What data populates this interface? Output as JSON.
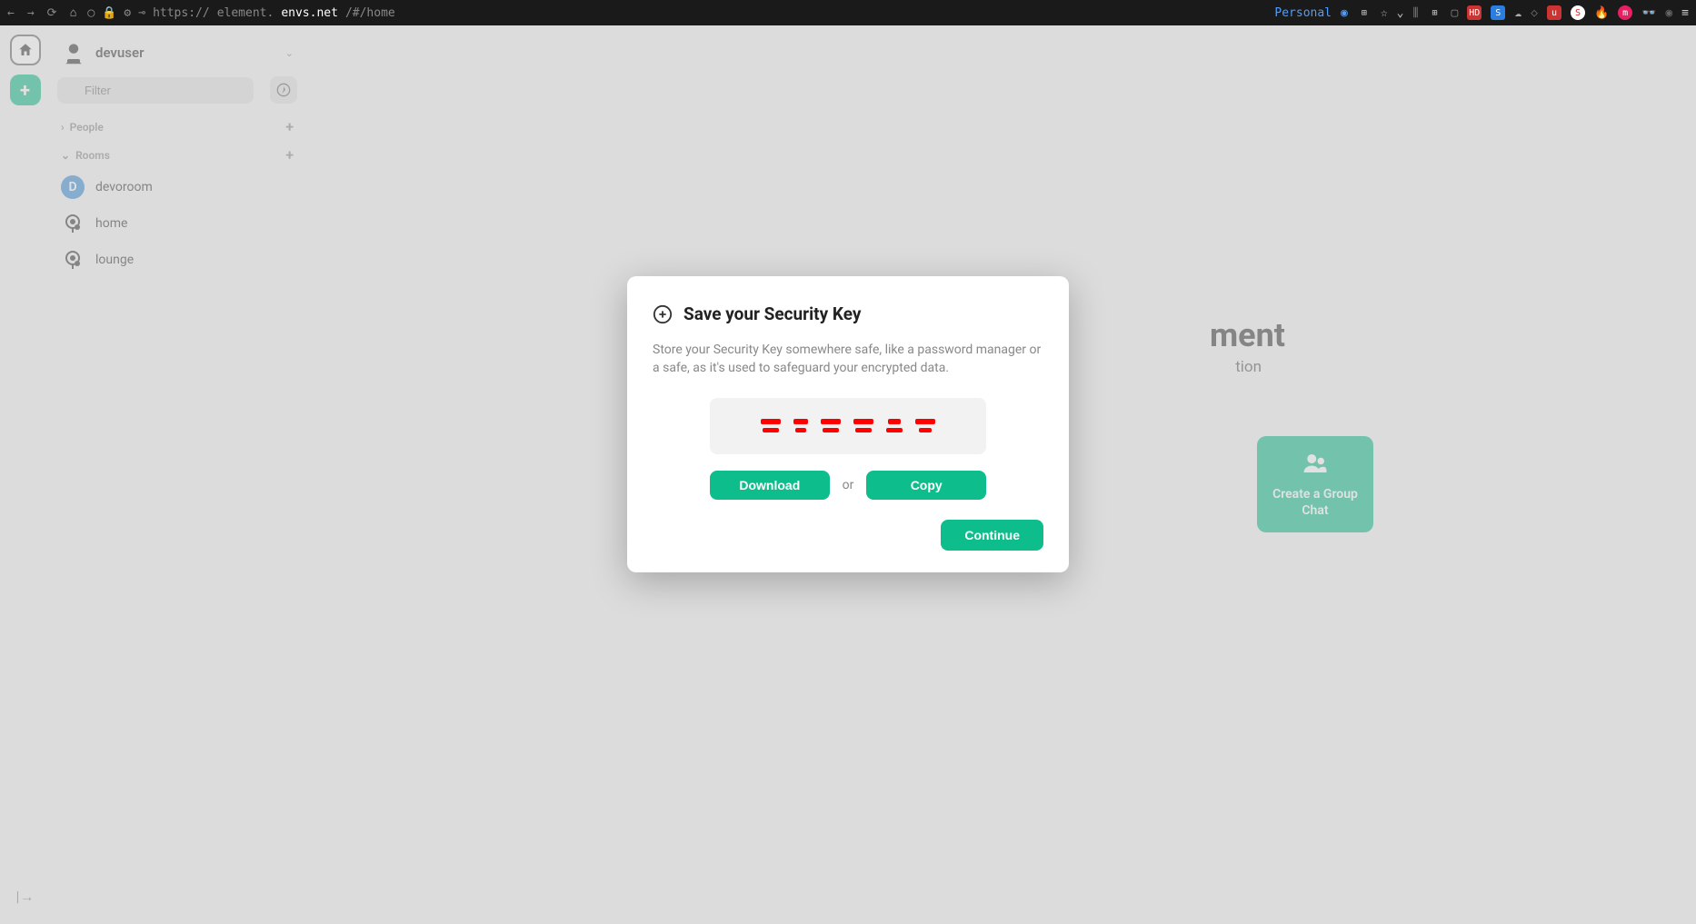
{
  "browser": {
    "url_prefix": "https://",
    "url_host": "element.",
    "url_domain": "envs.net",
    "url_path": "/#/home",
    "personal_label": "Personal"
  },
  "user": {
    "name": "devuser"
  },
  "filter": {
    "placeholder": "Filter"
  },
  "sections": {
    "people": "People",
    "rooms": "Rooms"
  },
  "rooms": [
    {
      "name": "devoroom",
      "initial": "D",
      "color": "#368bd6",
      "type": "badge"
    },
    {
      "name": "home",
      "type": "pin"
    },
    {
      "name": "lounge",
      "type": "pin"
    }
  ],
  "home": {
    "title_partial": "ment",
    "subtitle_partial": "tion",
    "card_label": "Create a Group Chat"
  },
  "modal": {
    "title": "Save your Security Key",
    "description": "Store your Security Key somewhere safe, like a password manager or a safe, as it's used to safeguard your encrypted data.",
    "download": "Download",
    "or": "or",
    "copy": "Copy",
    "continue": "Continue"
  }
}
